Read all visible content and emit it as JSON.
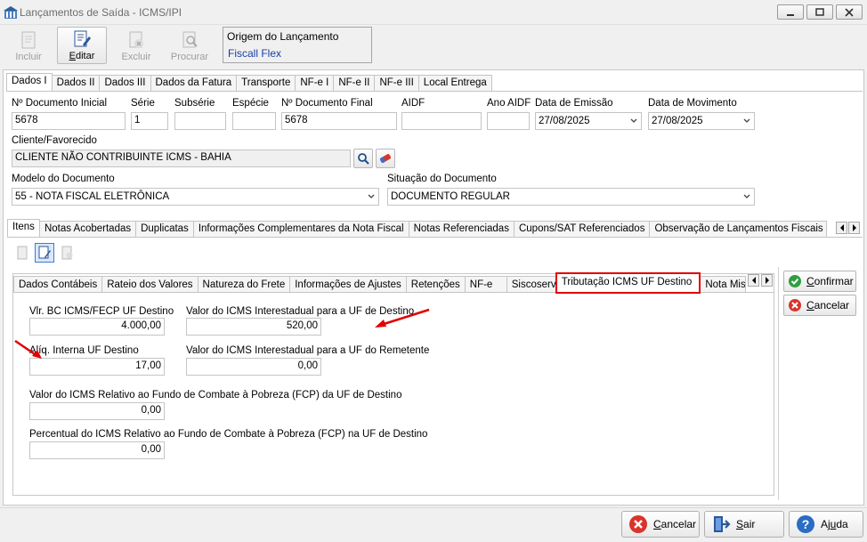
{
  "window": {
    "title": "Lançamentos de Saída - ICMS/IPI"
  },
  "toolbar": {
    "incluir": "Incluir",
    "editar": "Editar",
    "excluir": "Excluir",
    "procurar": "Procurar"
  },
  "origem": {
    "label": "Origem do Lançamento",
    "value": "Fiscall Flex"
  },
  "main_tabs": [
    "Dados I",
    "Dados II",
    "Dados III",
    "Dados da Fatura",
    "Transporte",
    "NF-e I",
    "NF-e II",
    "NF-e III",
    "Local Entrega"
  ],
  "dados": {
    "num_doc_inicial": {
      "label": "Nº Documento Inicial",
      "value": "5678"
    },
    "serie": {
      "label": "Série",
      "value": "1"
    },
    "subserie": {
      "label": "Subsérie",
      "value": ""
    },
    "especie": {
      "label": "Espécie",
      "value": ""
    },
    "num_doc_final": {
      "label": "Nº Documento Final",
      "value": "5678"
    },
    "aidf": {
      "label": "AIDF",
      "value": ""
    },
    "ano_aidf": {
      "label": "Ano AIDF",
      "value": ""
    },
    "data_emissao": {
      "label": "Data de Emissão",
      "value": "27/08/2025"
    },
    "data_movimento": {
      "label": "Data de Movimento",
      "value": "27/08/2025"
    },
    "cliente": {
      "label": "Cliente/Favorecido",
      "value": "CLIENTE NÃO CONTRIBUINTE ICMS - BAHIA"
    },
    "modelo": {
      "label": "Modelo do Documento",
      "value": "55 - NOTA FISCAL ELETRÔNICA"
    },
    "situacao": {
      "label": "Situação do Documento",
      "value": "DOCUMENTO REGULAR"
    }
  },
  "item_tabs": [
    "Itens",
    "Notas Acobertadas",
    "Duplicatas",
    "Informações Complementares da Nota Fiscal",
    "Notas Referenciadas",
    "Cupons/SAT Referenciados",
    "Observação de Lançamentos Fiscais (C"
  ],
  "sub_tabs": [
    "Dados Contábeis",
    "Rateio dos Valores",
    "Natureza do Frete",
    "Informações de Ajustes",
    "Retenções",
    "NF-e",
    "Siscoserv",
    "Tributação ICMS UF Destino",
    "Nota Mist"
  ],
  "difal": {
    "vlr_bc": {
      "label": "Vlr. BC ICMS/FECP UF Destino",
      "value": "4.000,00"
    },
    "aliq_interna": {
      "label": "Alíq. Interna UF Destino",
      "value": "17,00"
    },
    "vlr_icms_dest": {
      "label": "Valor do ICMS Interestadual para a UF de Destino",
      "value": "520,00"
    },
    "vlr_icms_rem": {
      "label": "Valor do ICMS Interestadual para a UF do Remetente",
      "value": "0,00"
    },
    "vlr_fcp": {
      "label": "Valor do ICMS Relativo ao Fundo de Combate à Pobreza (FCP) da UF de Destino",
      "value": "0,00"
    },
    "perc_fcp": {
      "label": "Percentual do ICMS Relativo ao Fundo de Combate à Pobreza (FCP) na UF de Destino",
      "value": "0,00"
    }
  },
  "side_buttons": {
    "confirmar": "Confirmar",
    "cancelar": "Cancelar"
  },
  "footer": {
    "cancelar": "Cancelar",
    "sair": "Sair",
    "ajuda": "Ajuda"
  },
  "colors": {
    "highlight": "#e00000",
    "link_blue": "#1a3fa0"
  }
}
